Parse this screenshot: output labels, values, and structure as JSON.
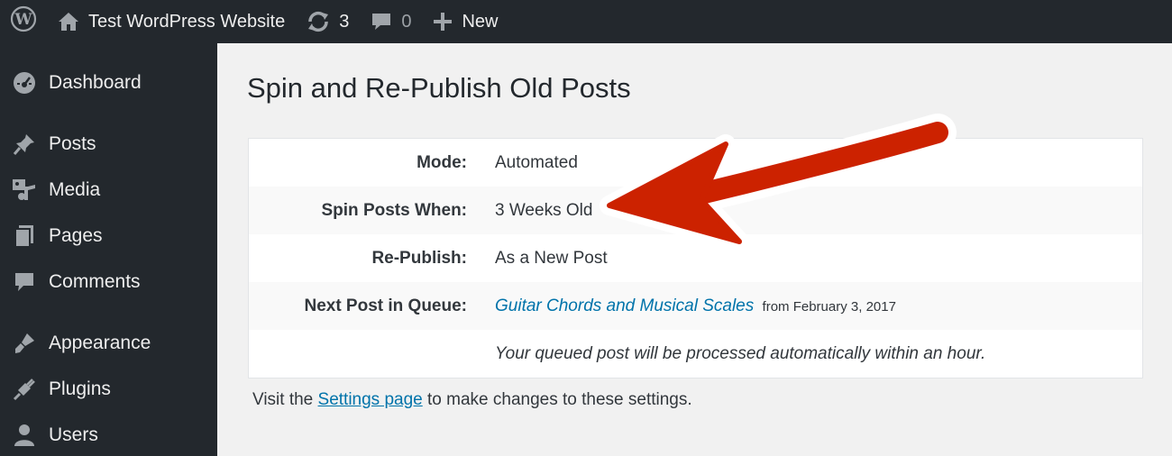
{
  "admin_bar": {
    "site_name": "Test WordPress Website",
    "updates_count": "3",
    "comments_count": "0",
    "new_label": "New"
  },
  "sidebar": {
    "items": [
      {
        "label": "Dashboard",
        "icon": "dashboard-icon"
      },
      {
        "label": "Posts",
        "icon": "pin-icon"
      },
      {
        "label": "Media",
        "icon": "media-icon"
      },
      {
        "label": "Pages",
        "icon": "pages-icon"
      },
      {
        "label": "Comments",
        "icon": "comment-icon"
      },
      {
        "label": "Appearance",
        "icon": "brush-icon"
      },
      {
        "label": "Plugins",
        "icon": "plug-icon"
      },
      {
        "label": "Users",
        "icon": "user-icon"
      }
    ]
  },
  "main": {
    "title": "Spin and Re-Publish Old Posts",
    "rows": [
      {
        "label": "Mode:",
        "value": "Automated"
      },
      {
        "label": "Spin Posts When:",
        "value": "3 Weeks Old"
      },
      {
        "label": "Re-Publish:",
        "value": "As a New Post"
      },
      {
        "label": "Next Post in Queue:",
        "link": "Guitar Chords and Musical Scales",
        "suffix": "from February 3, 2017"
      },
      {
        "label": "",
        "value": "Your queued post will be processed automatically within an hour."
      }
    ],
    "footer": {
      "before": "Visit the",
      "link": "Settings page",
      "after": "to make changes to these settings."
    }
  },
  "colors": {
    "admin_bg": "#23282d",
    "link": "#0073aa",
    "arrow": "#cc2200"
  }
}
